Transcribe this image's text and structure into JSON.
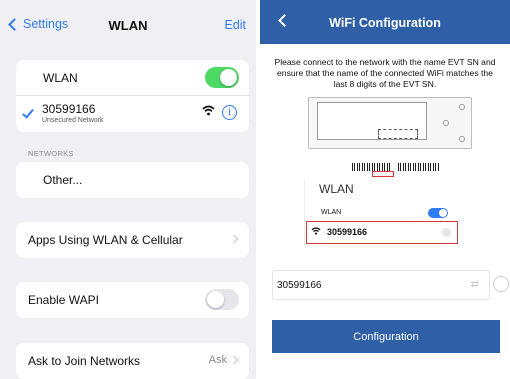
{
  "settings": {
    "back_label": "Settings",
    "title": "WLAN",
    "edit_label": "Edit",
    "wlan_label": "WLAN",
    "wlan_enabled": true,
    "connected_network": {
      "name": "30599166",
      "security": "Unsecured Network"
    },
    "networks_header": "NETWORKS",
    "other_label": "Other...",
    "apps_label": "Apps Using WLAN & Cellular",
    "wapi_label": "Enable WAPI",
    "wapi_enabled": false,
    "ask_label": "Ask to Join Networks",
    "ask_value": "Ask"
  },
  "config": {
    "title": "WiFi Configuration",
    "description": "Please connect to the network with the name EVT SN and ensure that the name of the connected WiFi matches the last 8 digits of the EVT SN.",
    "example_wlan_title": "WLAN",
    "example_wlan_label": "WLAN",
    "example_network": "30599166",
    "ssid_value": "30599166",
    "button_label": "Configuration"
  },
  "colors": {
    "ios_blue": "#2f7cf6",
    "toggle_on": "#4cd964",
    "header_blue": "#2f5fa7",
    "highlight_red": "#d9383a"
  },
  "icons": [
    "chevron-left-icon",
    "checkmark-icon",
    "wifi-icon",
    "info-icon",
    "chevron-right-icon",
    "swap-icon"
  ]
}
